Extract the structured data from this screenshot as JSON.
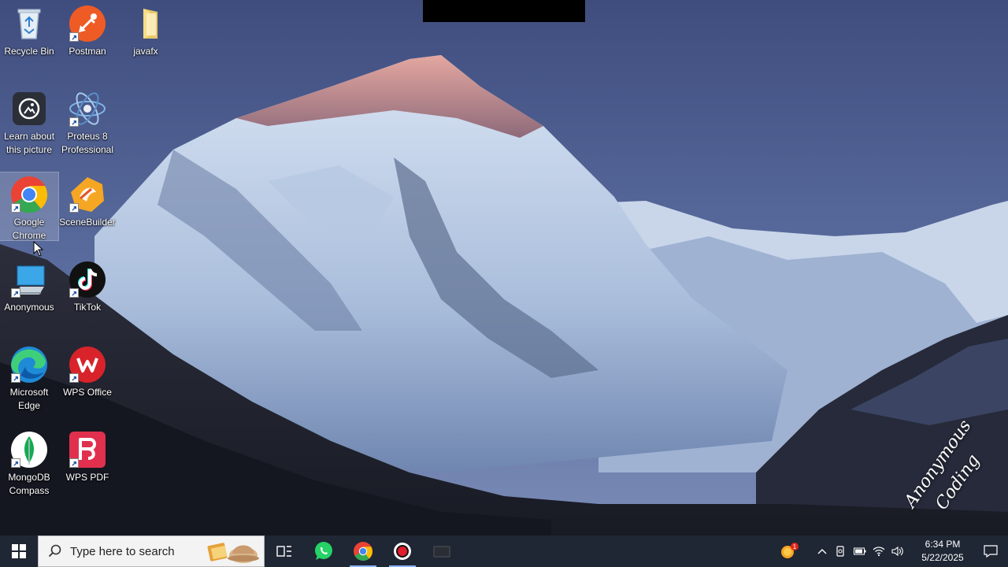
{
  "desktop": {
    "icons": [
      {
        "label": "Recycle Bin",
        "icon": "recycle-bin-icon"
      },
      {
        "label": "Postman",
        "icon": "postman-icon"
      },
      {
        "label": "javafx",
        "icon": "folder-icon"
      },
      {
        "label": "Learn about this picture",
        "icon": "camera-icon"
      },
      {
        "label": "Proteus 8 Professional",
        "icon": "proteus-icon"
      },
      {
        "label": "Google Chrome",
        "icon": "chrome-icon"
      },
      {
        "label": "SceneBuilder",
        "icon": "scenebuilder-icon"
      },
      {
        "label": "Anonymous",
        "icon": "computer-icon"
      },
      {
        "label": "TikTok",
        "icon": "tiktok-icon"
      },
      {
        "label": "Microsoft Edge",
        "icon": "edge-icon"
      },
      {
        "label": "WPS Office",
        "icon": "wps-office-icon"
      },
      {
        "label": "MongoDB Compass",
        "icon": "mongodb-icon"
      },
      {
        "label": "WPS PDF",
        "icon": "wps-pdf-icon"
      }
    ],
    "watermark": "Anonymous Coding"
  },
  "taskbar": {
    "search_placeholder": "Type here to search",
    "apps": [
      "task-view-icon",
      "whatsapp-icon",
      "chrome-icon",
      "screen-recorder-icon",
      "app-icon"
    ],
    "weather_badge": "1",
    "time": "6:34 PM",
    "date": "5/22/2025"
  },
  "colors": {
    "taskbar": "#1f2634",
    "sky": "#4a5a8a",
    "chrome_red": "#ea4335",
    "chrome_green": "#34a853",
    "chrome_yellow": "#fbbc05",
    "chrome_blue": "#4285f4"
  }
}
